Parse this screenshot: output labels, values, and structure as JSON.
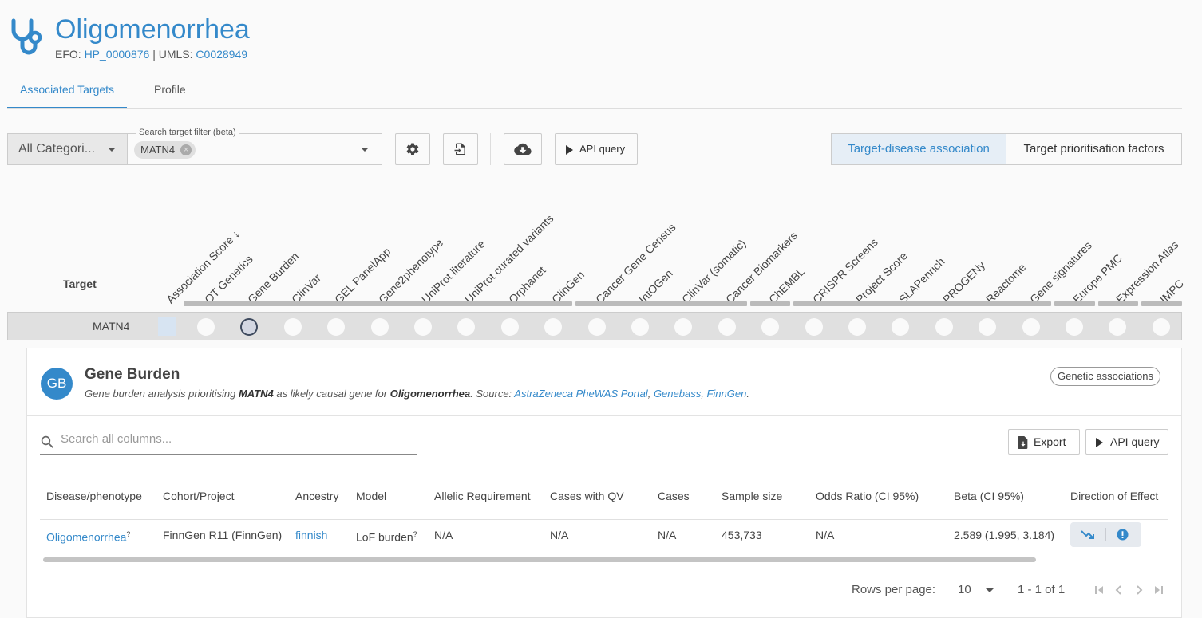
{
  "header": {
    "title": "Oligomenorrhea",
    "efo_label": "EFO:",
    "efo_id": "HP_0000876",
    "sep": "|",
    "umls_label": "UMLS:",
    "umls_id": "C0028949"
  },
  "tabs": [
    {
      "label": "Associated Targets",
      "active": true
    },
    {
      "label": "Profile",
      "active": false
    }
  ],
  "controls": {
    "category_select": "All Categori...",
    "search_filter_legend": "Search target filter (beta)",
    "filter_chip": "MATN4",
    "api_query": "API query",
    "view_options": [
      "Target-disease association",
      "Target prioritisation factors"
    ],
    "active_view": 0
  },
  "matrix": {
    "target_header": "Target",
    "columns": [
      "Association Score ↓",
      "OT Genetics",
      "Gene Burden",
      "ClinVar",
      "GEL PanelApp",
      "Gene2phenotype",
      "UniProt literature",
      "UniProt curated variants",
      "Orphanet",
      "ClinGen",
      "Cancer Gene Census",
      "IntOGen",
      "ClinVar (somatic)",
      "Cancer Biomarkers",
      "ChEMBL",
      "CRISPR Screens",
      "Project Score",
      "SLAPenrich",
      "PROGENy",
      "Reactome",
      "Gene signatures",
      "Europe PMC",
      "Expression Atlas",
      "IMPC"
    ],
    "selected_column": "Gene Burden",
    "row_target": "MATN4"
  },
  "panel": {
    "avatar": "GB",
    "title": "Gene Burden",
    "desc_prefix": "Gene burden analysis prioritising ",
    "desc_gene": "MATN4",
    "desc_mid": " as likely causal gene for ",
    "desc_disease": "Oligomenorrhea",
    "desc_source": ". Source: ",
    "source_1": "AstraZeneca PheWAS Portal",
    "comma1": ", ",
    "source_2": "Genebass",
    "comma2": ", ",
    "source_3": "FinnGen",
    "period": ".",
    "tag": "Genetic associations",
    "search_placeholder": "Search all columns...",
    "export": "Export",
    "api_query": "API query"
  },
  "table": {
    "headers": [
      "Disease/phenotype",
      "Cohort/Project",
      "Ancestry",
      "Model",
      "Allelic Requirement",
      "Cases with QV",
      "Cases",
      "Sample size",
      "Odds Ratio (CI 95%)",
      "Beta (CI 95%)",
      "Direction of Effect"
    ],
    "row": {
      "disease": "Oligomenorrhea",
      "disease_sup": "?",
      "cohort": "FinnGen R11 (FinnGen)",
      "ancestry": "finnish",
      "model": "LoF burden",
      "model_sup": "?",
      "allelic": "N/A",
      "cases_qv": "N/A",
      "cases": "N/A",
      "sample_size": "453,733",
      "odds_ratio": "N/A",
      "beta": "2.589 (1.995, 3.184)"
    }
  },
  "pagination": {
    "rows_label": "Rows per page:",
    "rows_value": "10",
    "range": "1 - 1 of 1"
  },
  "colors": {
    "brand": "#3489ca",
    "selected_dot": "#3e4a5e"
  }
}
